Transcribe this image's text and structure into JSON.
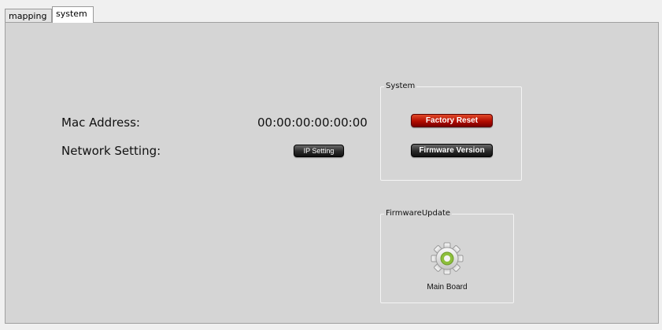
{
  "tabs": [
    {
      "label": "mapping",
      "active": false
    },
    {
      "label": "system",
      "active": true
    }
  ],
  "info": {
    "mac_label": "Mac Address:",
    "mac_value": "00:00:00:00:00:00",
    "network_label": "Network Setting:",
    "ip_button": "IP Setting"
  },
  "system_group": {
    "title": "System",
    "factory_reset": "Factory Reset",
    "firmware_version": "Firmware Version"
  },
  "firmware_update": {
    "title": "FirmwareUpdate",
    "main_board_label": "Main Board",
    "icon": "gear-icon"
  },
  "colors": {
    "panel_bg": "#d5d5d5",
    "reset_button": "#b30c00",
    "dark_button": "#2a2a2a",
    "gear_accent": "#8dbf3c"
  }
}
